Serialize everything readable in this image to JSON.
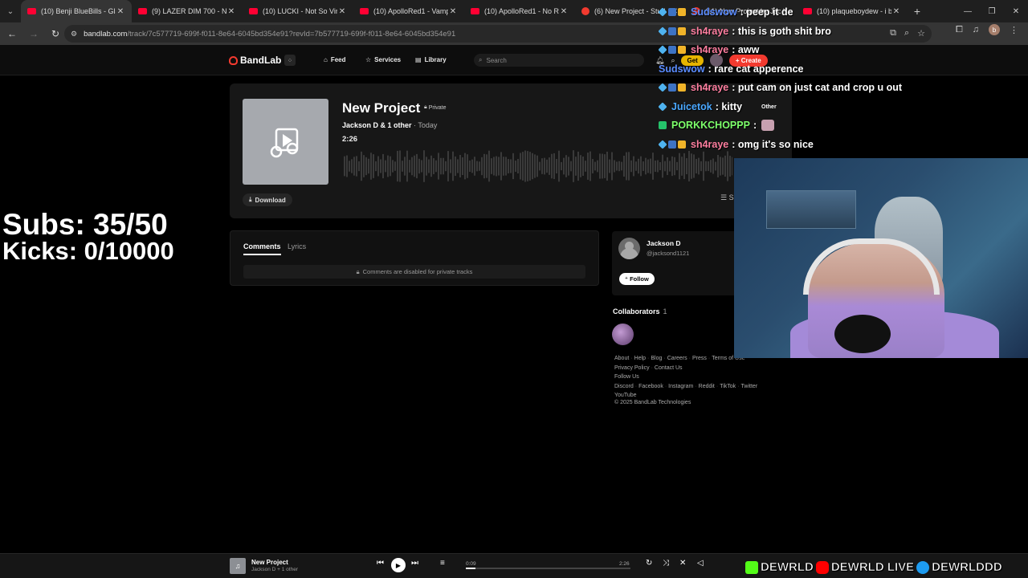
{
  "browser": {
    "tabs": [
      {
        "title": "(10) Benji BlueBills - Glas",
        "favicon": "youtube",
        "active": true
      },
      {
        "title": "(9) LAZER DIM 700 - NEX",
        "favicon": "youtube"
      },
      {
        "title": "(10) LUCKI - Not So Virgo",
        "favicon": "youtube"
      },
      {
        "title": "(10) ApolloRed1 - Vamp L",
        "favicon": "youtube"
      },
      {
        "title": "(10) ApolloRed1 - No Run",
        "favicon": "youtube"
      },
      {
        "title": "(6) New Project - Stud",
        "favicon": "bandlab"
      },
      {
        "title": "(11) New Project by Jack",
        "favicon": "bandlab"
      },
      {
        "title": "(10) plaqueboydew - i be",
        "favicon": "youtube"
      }
    ],
    "url_host": "bandlab.com",
    "url_path": "/track/7c577719-699f-f011-8e64-6045bd354e91?revId=7b577719-699f-f011-8e64-6045bd354e91",
    "profile_initial": "b"
  },
  "header": {
    "logo": "BandLab",
    "nav": {
      "feed": "Feed",
      "services": "Services",
      "library": "Library"
    },
    "search_placeholder": "Search",
    "get_label": "Get",
    "create_label": "Create"
  },
  "track": {
    "title": "New Project",
    "privacy": "Private",
    "artists": "Jackson D & 1 other",
    "date": "· Today",
    "duration": "2:26",
    "download_label": "Download",
    "sort_label": "☰ S"
  },
  "comments": {
    "tabs": {
      "comments": "Comments",
      "lyrics": "Lyrics"
    },
    "disabled_message": "Comments are disabled for private tracks"
  },
  "creator": {
    "name": "Jackson D",
    "handle": "@jacksond1121",
    "follow_label": "Follow"
  },
  "collaborators": {
    "label": "Collaborators",
    "count": "1"
  },
  "footer": {
    "row1": [
      "About",
      "Help",
      "Blog",
      "Careers",
      "Press",
      "Terms of Use"
    ],
    "row2": [
      "Privacy Policy",
      "Contact Us"
    ],
    "follow_us": "Follow Us",
    "row3": [
      "Discord",
      "Facebook",
      "Instagram",
      "Reddit",
      "TikTok",
      "Twitter"
    ],
    "row4": [
      "YouTube"
    ],
    "copyright": "© 2025 BandLab Technologies"
  },
  "player": {
    "title": "New Project",
    "subtitle": "Jackson D + 1 other",
    "current_time": "0:09",
    "total_time": "2:26",
    "progress": 0.06
  },
  "overlay": {
    "subs": "Subs: 35/50",
    "kicks": "Kicks: 0/10000",
    "chat": [
      {
        "name": "Sudswow",
        "name_color": "#5b8cff",
        "message": ": peep it de",
        "badges": [
          "diamond",
          "sub",
          "crown"
        ]
      },
      {
        "name": "sh4raye",
        "name_color": "#ff7fa0",
        "message": ": this is goth shit bro",
        "badges": [
          "diamond",
          "sub",
          "crown"
        ]
      },
      {
        "name": "sh4raye",
        "name_color": "#ff7fa0",
        "message": ": aww",
        "badges": [
          "diamond",
          "sub",
          "crown"
        ]
      },
      {
        "name": "Sudswow",
        "name_color": "#5b8cff",
        "message": ": rare cat apperence",
        "badges": []
      },
      {
        "name": "sh4raye",
        "name_color": "#ff7fa0",
        "message": ": put cam on just cat and crop u out",
        "badges": [
          "diamond",
          "sub",
          "crown"
        ]
      },
      {
        "name": "Juicetok",
        "name_color": "#4aa8ff",
        "message": ": kitty",
        "badges": [
          "diamond"
        ]
      },
      {
        "name": "PORKKCHOPPP",
        "name_color": "#7dff6b",
        "message": ":",
        "badges": [
          "green"
        ],
        "emote": true
      },
      {
        "name": "sh4raye",
        "name_color": "#ff7fa0",
        "message": ": omg it's so nice",
        "badges": [
          "diamond",
          "sub",
          "crown"
        ]
      }
    ],
    "other_tag": "Other",
    "socials": {
      "kick": "DEWRLD",
      "youtube": "DEWRLD LIVE",
      "twitter": "DEWRLDDD"
    }
  }
}
